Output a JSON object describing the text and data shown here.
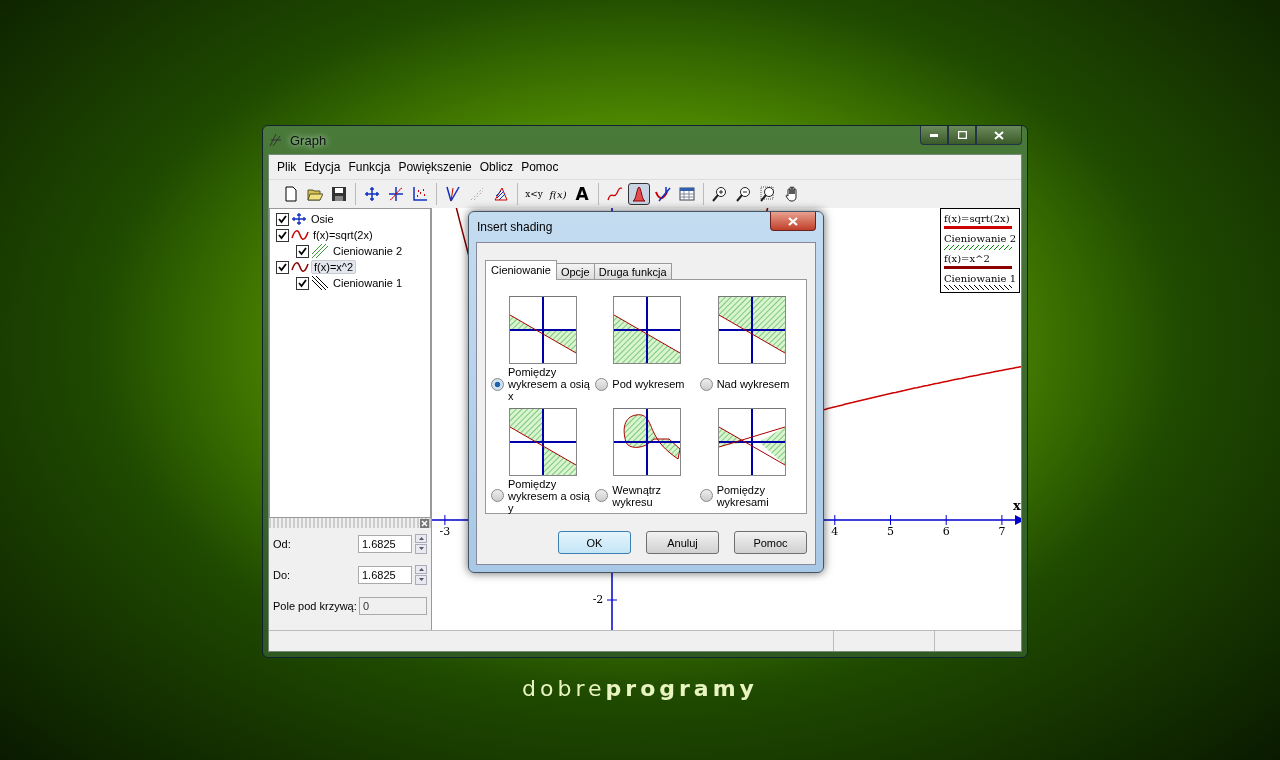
{
  "window": {
    "title": "Graph"
  },
  "menu": [
    "Plik",
    "Edycja",
    "Funkcja",
    "Powiększenie",
    "Oblicz",
    "Pomoc"
  ],
  "toolbar": [
    [
      {
        "kind": "new-file",
        "pressed": false
      },
      {
        "kind": "open-folder",
        "pressed": false
      },
      {
        "kind": "save",
        "pressed": false
      }
    ],
    [
      {
        "kind": "axes",
        "pressed": false
      },
      {
        "kind": "function-on-axes",
        "pressed": false
      },
      {
        "kind": "points",
        "pressed": false
      }
    ],
    [
      {
        "kind": "v-lines",
        "pressed": false
      },
      {
        "kind": "dashed-line",
        "pressed": false
      },
      {
        "kind": "hatch",
        "pressed": false
      }
    ],
    [
      {
        "kind": "text",
        "label": "x<y",
        "pressed": false
      },
      {
        "kind": "italic-text",
        "label": "f(x)",
        "pressed": false
      },
      {
        "kind": "big-text",
        "label": "A",
        "pressed": false
      }
    ],
    [
      {
        "kind": "curve",
        "pressed": false
      },
      {
        "kind": "shading",
        "pressed": true
      },
      {
        "kind": "tangent",
        "pressed": false
      },
      {
        "kind": "table",
        "pressed": false
      }
    ],
    [
      {
        "kind": "zoom-in",
        "pressed": false
      },
      {
        "kind": "zoom-out",
        "pressed": false
      },
      {
        "kind": "zoom-box",
        "pressed": false
      },
      {
        "kind": "hand",
        "pressed": false
      }
    ]
  ],
  "tree": [
    {
      "kind": "axes",
      "label": "Osie",
      "checked": true,
      "selected": false
    },
    {
      "kind": "function",
      "label": "f(x)=sqrt(2x)",
      "checked": true,
      "selected": false,
      "color": "#cc0000",
      "children": [
        {
          "kind": "hatch-green",
          "label": "Cieniowanie 2",
          "checked": true,
          "selected": false
        }
      ]
    },
    {
      "kind": "function",
      "label": "f(x)=x^2",
      "checked": true,
      "selected": true,
      "color": "#8b0000",
      "children": [
        {
          "kind": "hatch-black",
          "label": "Cieniowanie 1",
          "checked": true,
          "selected": false
        }
      ]
    }
  ],
  "fields": [
    {
      "label": "Od:",
      "value": "1.6825",
      "disabled": false
    },
    {
      "label": "Do:",
      "value": "1.6825",
      "disabled": false
    },
    {
      "label": "Pole pod krzywą:",
      "value": "0",
      "disabled": true
    }
  ],
  "graph": {
    "x_axis_label": "x",
    "x_ticks": [
      "-3",
      "4",
      "5",
      "6",
      "7"
    ],
    "y_ticks": [
      "-2"
    ]
  },
  "legend": [
    {
      "kind": "line",
      "label": "f(x)=sqrt(2x)",
      "color": "#cc0000"
    },
    {
      "kind": "hatch",
      "label": "Cieniowanie 2",
      "color": "#008800"
    },
    {
      "kind": "line",
      "label": "f(x)=x^2",
      "color": "#8b0000"
    },
    {
      "kind": "hatch",
      "label": "Cieniowanie 1",
      "color": "#000000"
    }
  ],
  "dialog": {
    "title": "Insert shading",
    "tabs": [
      {
        "label": "Cieniowanie",
        "selected": true
      },
      {
        "label": "Opcje",
        "selected": false
      },
      {
        "label": "Druga funkcja",
        "selected": false
      }
    ],
    "options": [
      {
        "kind": "between-x",
        "label": "Pomiędzy wykresem a osią x",
        "selected": true
      },
      {
        "kind": "below",
        "label": "Pod wykresem",
        "selected": false
      },
      {
        "kind": "above",
        "label": "Nad wykresem",
        "selected": false
      },
      {
        "kind": "between-y",
        "label": "Pomiędzy wykresem a osią y",
        "selected": false
      },
      {
        "kind": "inside",
        "label": "Wewnątrz wykresu",
        "selected": false
      },
      {
        "kind": "between-graphs",
        "label": "Pomiędzy wykresami",
        "selected": false
      }
    ],
    "buttons": [
      {
        "label": "OK",
        "default": true
      },
      {
        "label": "Anuluj",
        "default": false
      },
      {
        "label": "Pomoc",
        "default": false
      }
    ]
  },
  "wallpaper_text": "dobre**programy**"
}
